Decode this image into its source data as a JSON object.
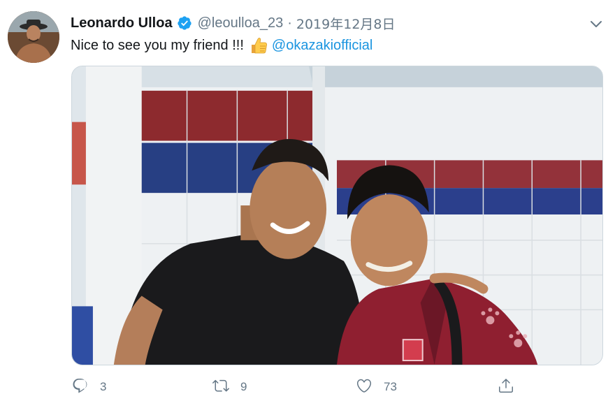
{
  "author": {
    "name": "Leonardo Ulloa",
    "handle": "@leoulloa_23",
    "separator": "·",
    "date": "2019年12月8日",
    "verified": true
  },
  "tweet": {
    "text": "Nice to see you my friend !!!",
    "emoji": "thumbs-up-icon",
    "mention": "@okazakiofficial"
  },
  "actions": {
    "replies": "3",
    "retweets": "9",
    "likes": "73"
  },
  "colors": {
    "link": "#1b95e0",
    "verified": "#1da1f2",
    "muted": "#657786"
  }
}
